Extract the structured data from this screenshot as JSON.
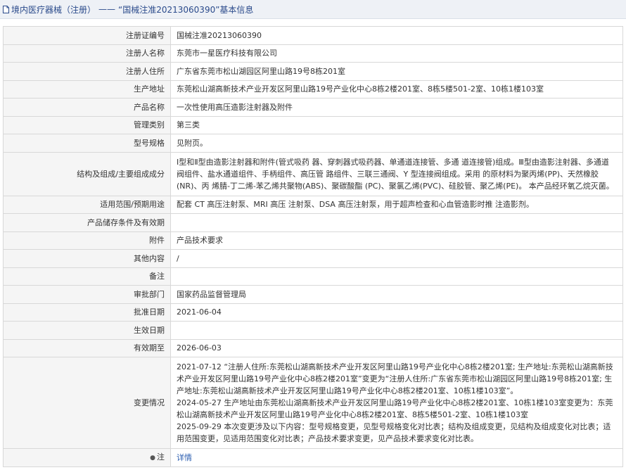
{
  "header": {
    "breadcrumb_link": "境内医疗器械（注册）",
    "separator": "——",
    "title": "“国械注准20213060390”基本信息"
  },
  "rows": [
    {
      "label": "注册证编号",
      "value": "国械注准20213060390"
    },
    {
      "label": "注册人名称",
      "value": "东莞市一星医疗科技有限公司"
    },
    {
      "label": "注册人住所",
      "value": "广东省东莞市松山湖园区阿里山路19号8栋201室"
    },
    {
      "label": "生产地址",
      "value": "东莞松山湖高新技术产业开发区阿里山路19号产业化中心8栋2楼201室、8栋5楼501-2室、10栋1楼103室"
    },
    {
      "label": "产品名称",
      "value": "一次性使用高压造影注射器及附件"
    },
    {
      "label": "管理类别",
      "value": "第三类"
    },
    {
      "label": "型号规格",
      "value": "见附页。"
    },
    {
      "label": "结构及组成/主要组成成分",
      "value": "Ⅰ型和Ⅱ型由造影注射器和附件(管式吸药 器、穿刺器式吸药器、单通道连接管、多通 道连接管)组成。Ⅲ型由造影注射器、多通道 阀组件、盐水通道组件、手柄组件、高压管 路组件、三联三通阀、Y 型连接阀组成。采用 的原材料为聚丙烯(PP)、天然橡胶(NR)、丙 烯腈-丁二烯-苯乙烯共聚物(ABS)、聚碳酸酯 (PC)、聚氯乙烯(PVC)、硅胶管、聚乙烯(PE)。 本产品经环氧乙烷灭菌。"
    },
    {
      "label": "适用范围/预期用途",
      "value": "配套 CT 高压注射泵、MRI 高压 注射泵、DSA 高压注射泵，用于超声检查和心血管造影时推 注造影剂。"
    },
    {
      "label": "产品储存条件及有效期",
      "value": ""
    },
    {
      "label": "附件",
      "value": "产品技术要求"
    },
    {
      "label": "其他内容",
      "value": "/"
    },
    {
      "label": "备注",
      "value": ""
    },
    {
      "label": "审批部门",
      "value": "国家药品监督管理局"
    },
    {
      "label": "批准日期",
      "value": "2021-06-04"
    },
    {
      "label": "生效日期",
      "value": ""
    },
    {
      "label": "有效期至",
      "value": "2026-06-03"
    }
  ],
  "changes": {
    "label": "变更情况",
    "entries": [
      "2021-07-12 “注册人住所:东莞松山湖高新技术产业开发区阿里山路19号产业化中心8栋2楼201室; 生产地址:东莞松山湖高新技术产业开发区阿里山路19号产业化中心8栋2楼201室”变更为“注册人住所:广东省东莞市松山湖园区阿里山路19号8栋201室; 生产地址:东莞松山湖高新技术产业开发区阿里山路19号产业化中心8栋2楼201室、10栋1楼103室”。",
      "2024-05-27 生产地址由东莞松山湖高新技术产业开发区阿里山路19号产业化中心8栋2楼201室、10栋1楼103室变更为：东莞松山湖高新技术产业开发区阿里山路19号产业化中心8栋2楼201室、8栋5楼501-2室、10栋1楼103室",
      "2025-09-29 本次变更涉及以下内容：型号规格变更，见型号规格变化对比表；结构及组成变更，见结构及组成变化对比表；适用范围变更，见适用范围变化对比表；产品技术要求变更，见产品技术要求变化对比表。"
    ]
  },
  "note": {
    "pin_icon": "location-pin-icon",
    "label": "注",
    "link": "详情"
  },
  "colors": {
    "header_bg": "#eef1f6",
    "header_text": "#2a4a8b",
    "label_bg": "#f5f5f5",
    "border": "#d8d8d8",
    "link": "#2a5db0"
  }
}
